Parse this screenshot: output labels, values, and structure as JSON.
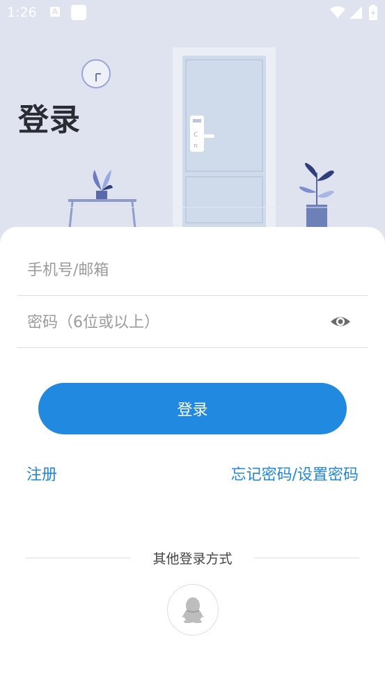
{
  "status_bar": {
    "time": "1:26",
    "notification_icons": [
      "a-icon",
      "square-icon"
    ],
    "right_icons": [
      "wifi-icon",
      "signal-icon",
      "battery-icon"
    ]
  },
  "header": {
    "title": "登录",
    "illustration": [
      "clock-icon",
      "door",
      "table",
      "plant"
    ]
  },
  "form": {
    "phone_placeholder": "手机号/邮箱",
    "password_placeholder": "密码（6位或以上）",
    "password_toggle_icon": "eye-icon",
    "login_label": "登录"
  },
  "links": {
    "register": "注册",
    "forgot": "忘记密码/设置密码"
  },
  "other_login": {
    "title": "其他登录方式",
    "options": [
      {
        "icon": "qq-icon"
      }
    ]
  },
  "colors": {
    "accent": "#2289e0",
    "link": "#1f87e0",
    "header_background": "#dfe3f0",
    "card_background": "#ffffff"
  }
}
